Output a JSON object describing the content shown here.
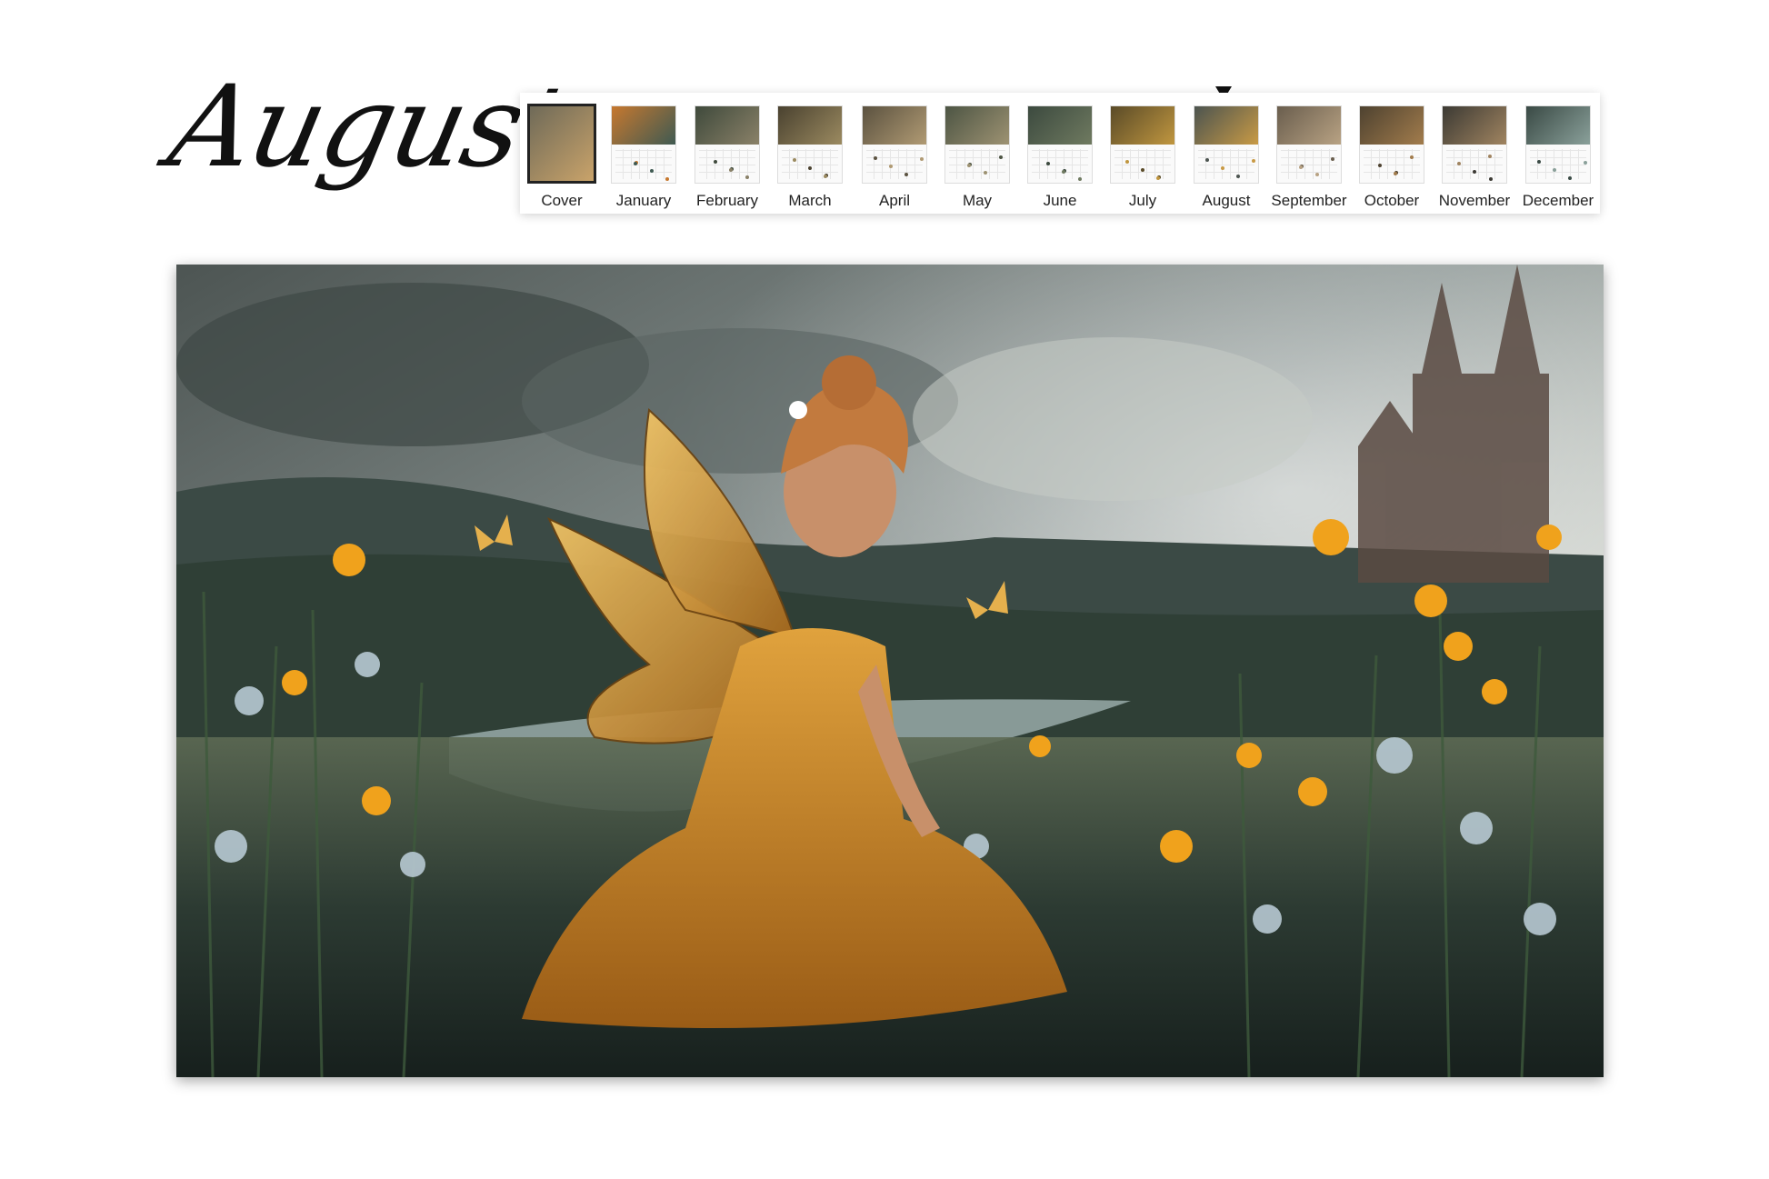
{
  "title": "August",
  "selected_month": "August",
  "thumbnails": [
    {
      "label": "Cover",
      "colors": [
        "#6f6a58",
        "#c9a36a"
      ]
    },
    {
      "label": "January",
      "colors": [
        "#c6782f",
        "#3f5a52"
      ]
    },
    {
      "label": "February",
      "colors": [
        "#3f4a3c",
        "#8a8168"
      ]
    },
    {
      "label": "March",
      "colors": [
        "#4a4230",
        "#9b8a60"
      ]
    },
    {
      "label": "April",
      "colors": [
        "#5b5240",
        "#b09a73"
      ]
    },
    {
      "label": "May",
      "colors": [
        "#4d5544",
        "#9d9272"
      ]
    },
    {
      "label": "June",
      "colors": [
        "#3c4a3f",
        "#6f7a60"
      ]
    },
    {
      "label": "July",
      "colors": [
        "#5a4b28",
        "#c0963f"
      ]
    },
    {
      "label": "August",
      "colors": [
        "#4c5450",
        "#c89a45"
      ]
    },
    {
      "label": "September",
      "colors": [
        "#6a5e4e",
        "#b8a283"
      ]
    },
    {
      "label": "October",
      "colors": [
        "#4e4230",
        "#a27c4c"
      ]
    },
    {
      "label": "November",
      "colors": [
        "#3c3a34",
        "#a08460"
      ]
    },
    {
      "label": "December",
      "colors": [
        "#3a4a45",
        "#8aa09a"
      ]
    }
  ]
}
